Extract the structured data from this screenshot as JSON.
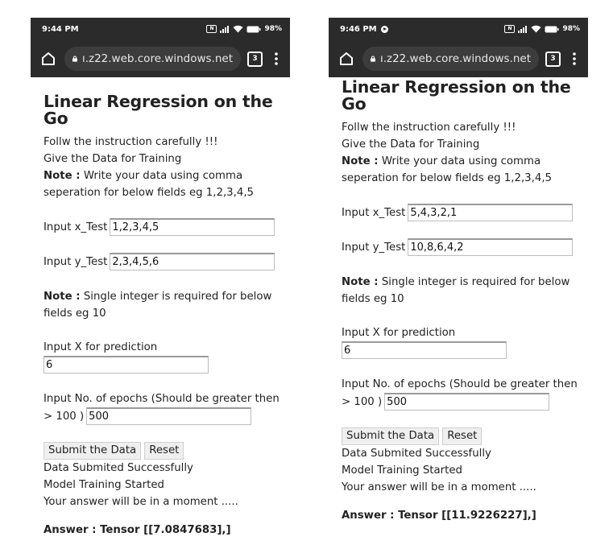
{
  "phones": [
    {
      "status": {
        "time": "9:44 PM",
        "battery": "98%",
        "nav_icon": ""
      },
      "browser": {
        "url": "ı.z22.web.core.windows.net",
        "tab_count": "3"
      },
      "page": {
        "title": "Linear Regression on the Go",
        "line1": "Follw the instruction carefully !!!",
        "line2": "Give the Data for Training",
        "note_label": "Note :",
        "note_text_a": "Write your data using comma",
        "note_text_b": "seperation for below fields eg 1,2,3,4,5",
        "x_label": "Input x_Test",
        "x_value": "1,2,3,4,5",
        "y_label": "Input y_Test",
        "y_value": "2,3,4,5,6",
        "note2_label": "Note :",
        "note2_text_a": "Single integer is required for below",
        "note2_text_b": "fields eg 10",
        "pred_label": "Input X for prediction",
        "pred_value": "6",
        "epochs_label_a": "Input No. of epochs (Should be greater then",
        "epochs_label_b": "> 100 )",
        "epochs_value": "500",
        "submit_label": "Submit the Data",
        "reset_label": "Reset",
        "status1": "Data Submited Successfully",
        "status2": "Model Training Started",
        "status3": "Your answer will be in a moment .....",
        "answer": "Answer : Tensor [[7.0847683],]"
      }
    },
    {
      "status": {
        "time": "9:46 PM",
        "battery": "98%",
        "nav_icon": "navigation-icon"
      },
      "browser": {
        "url": "ı.z22.web.core.windows.net",
        "tab_count": "3"
      },
      "page": {
        "title": "Linear Regression on the Go",
        "line1": "Follw the instruction carefully !!!",
        "line2": "Give the Data for Training",
        "note_label": "Note :",
        "note_text_a": "Write your data using comma",
        "note_text_b": "seperation for below fields eg 1,2,3,4,5",
        "x_label": "Input x_Test",
        "x_value": "5,4,3,2,1",
        "y_label": "Input y_Test",
        "y_value": "10,8,6,4,2",
        "note2_label": "Note :",
        "note2_text_a": "Single integer is required for below",
        "note2_text_b": "fields eg 10",
        "pred_label": "Input X for prediction",
        "pred_value": "6",
        "epochs_label_a": "Input No. of epochs (Should be greater then",
        "epochs_label_b": "> 100 )",
        "epochs_value": "500",
        "submit_label": "Submit the Data",
        "reset_label": "Reset",
        "status1": "Data Submited Successfully",
        "status2": "Model Training Started",
        "status3": "Your answer will be in a moment .....",
        "answer": "Answer : Tensor [[11.9226227],]"
      }
    }
  ]
}
